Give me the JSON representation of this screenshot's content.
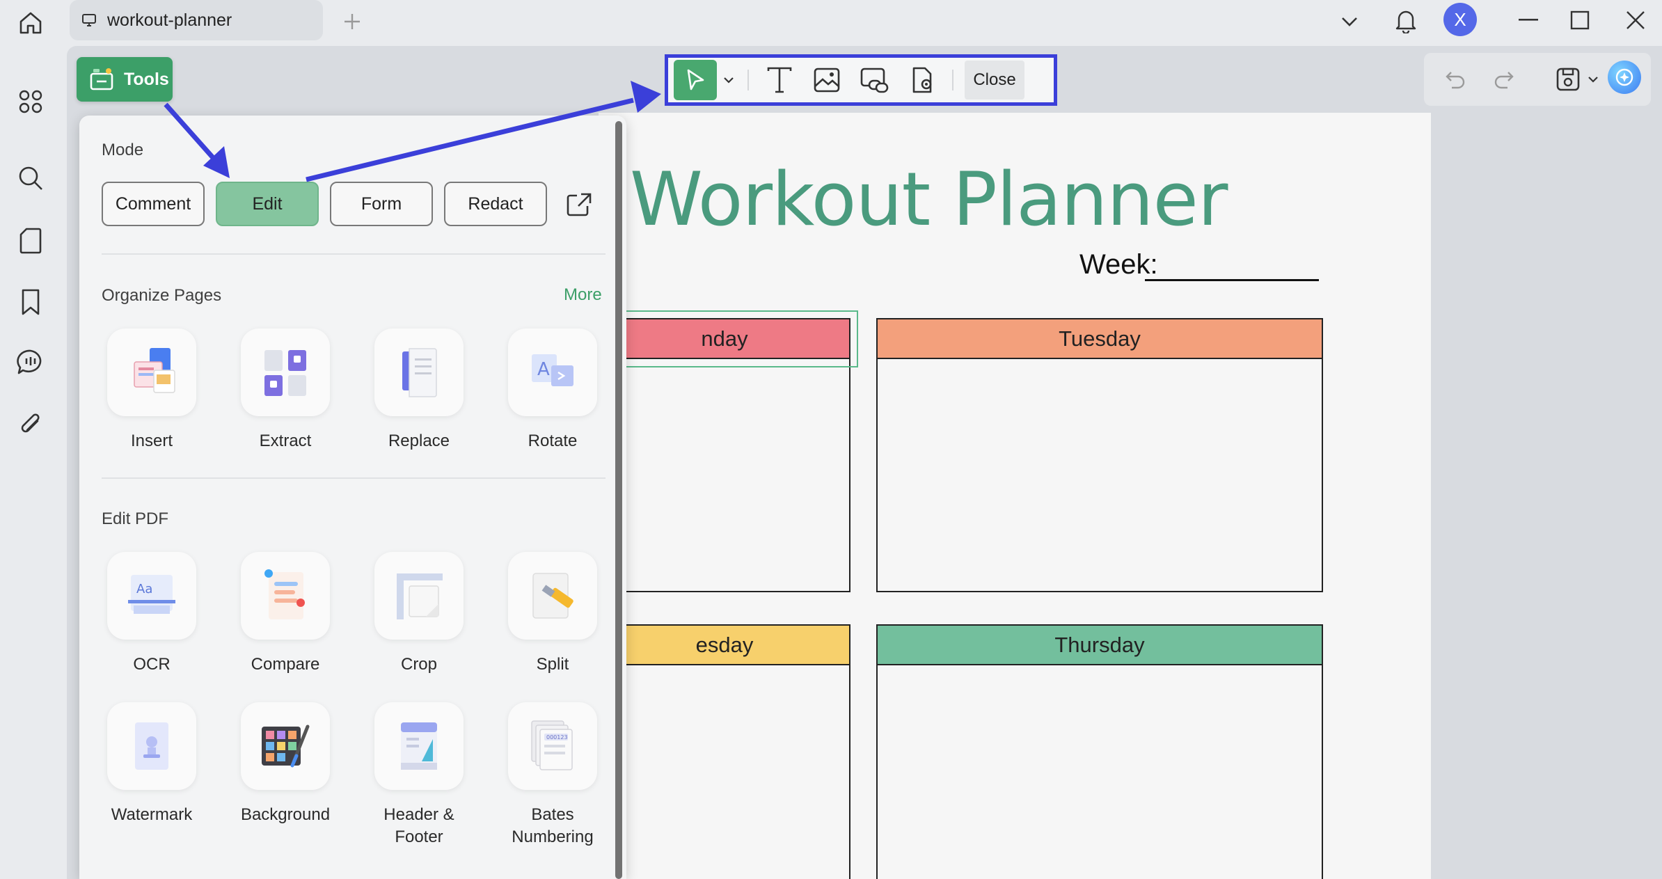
{
  "titlebar": {
    "tab_title": "workout-planner",
    "avatar_letter": "X"
  },
  "left_rail": {
    "icons": [
      "apps-grid-icon",
      "search-icon",
      "pages-icon",
      "bookmark-icon",
      "comments-icon",
      "attachment-icon"
    ]
  },
  "toolbar": {
    "tools_label": "Tools",
    "edit_close_label": "Close",
    "edit_tools": [
      "select-cursor-icon",
      "text-icon",
      "image-icon",
      "link-icon",
      "stamp-icon"
    ],
    "right_tools": [
      "undo-icon",
      "redo-icon",
      "save-icon",
      "ai-assistant-icon"
    ]
  },
  "tools_panel": {
    "mode_heading": "Mode",
    "modes": [
      "Comment",
      "Edit",
      "Form",
      "Redact"
    ],
    "active_mode": "Edit",
    "organize_heading": "Organize Pages",
    "more_label": "More",
    "organize_tools": [
      "Insert",
      "Extract",
      "Replace",
      "Rotate"
    ],
    "edit_heading": "Edit PDF",
    "edit_tools": [
      "OCR",
      "Compare",
      "Crop",
      "Split"
    ],
    "edit_tools_row2": [
      "Watermark",
      "Background",
      "Header &\nFooter",
      "Bates\nNumbering"
    ]
  },
  "document": {
    "title": "Workout Planner",
    "week_label": "Week:",
    "days": [
      "nday",
      "Tuesday",
      "esday",
      "Thursday"
    ],
    "day_colors": [
      "#ee7a85",
      "#f3a07c",
      "#f7d06c",
      "#73bf9d"
    ]
  },
  "colors": {
    "accent_green": "#3c9f68",
    "annotation_blue": "#3b3fd9",
    "title_green": "#4a9b7e"
  }
}
